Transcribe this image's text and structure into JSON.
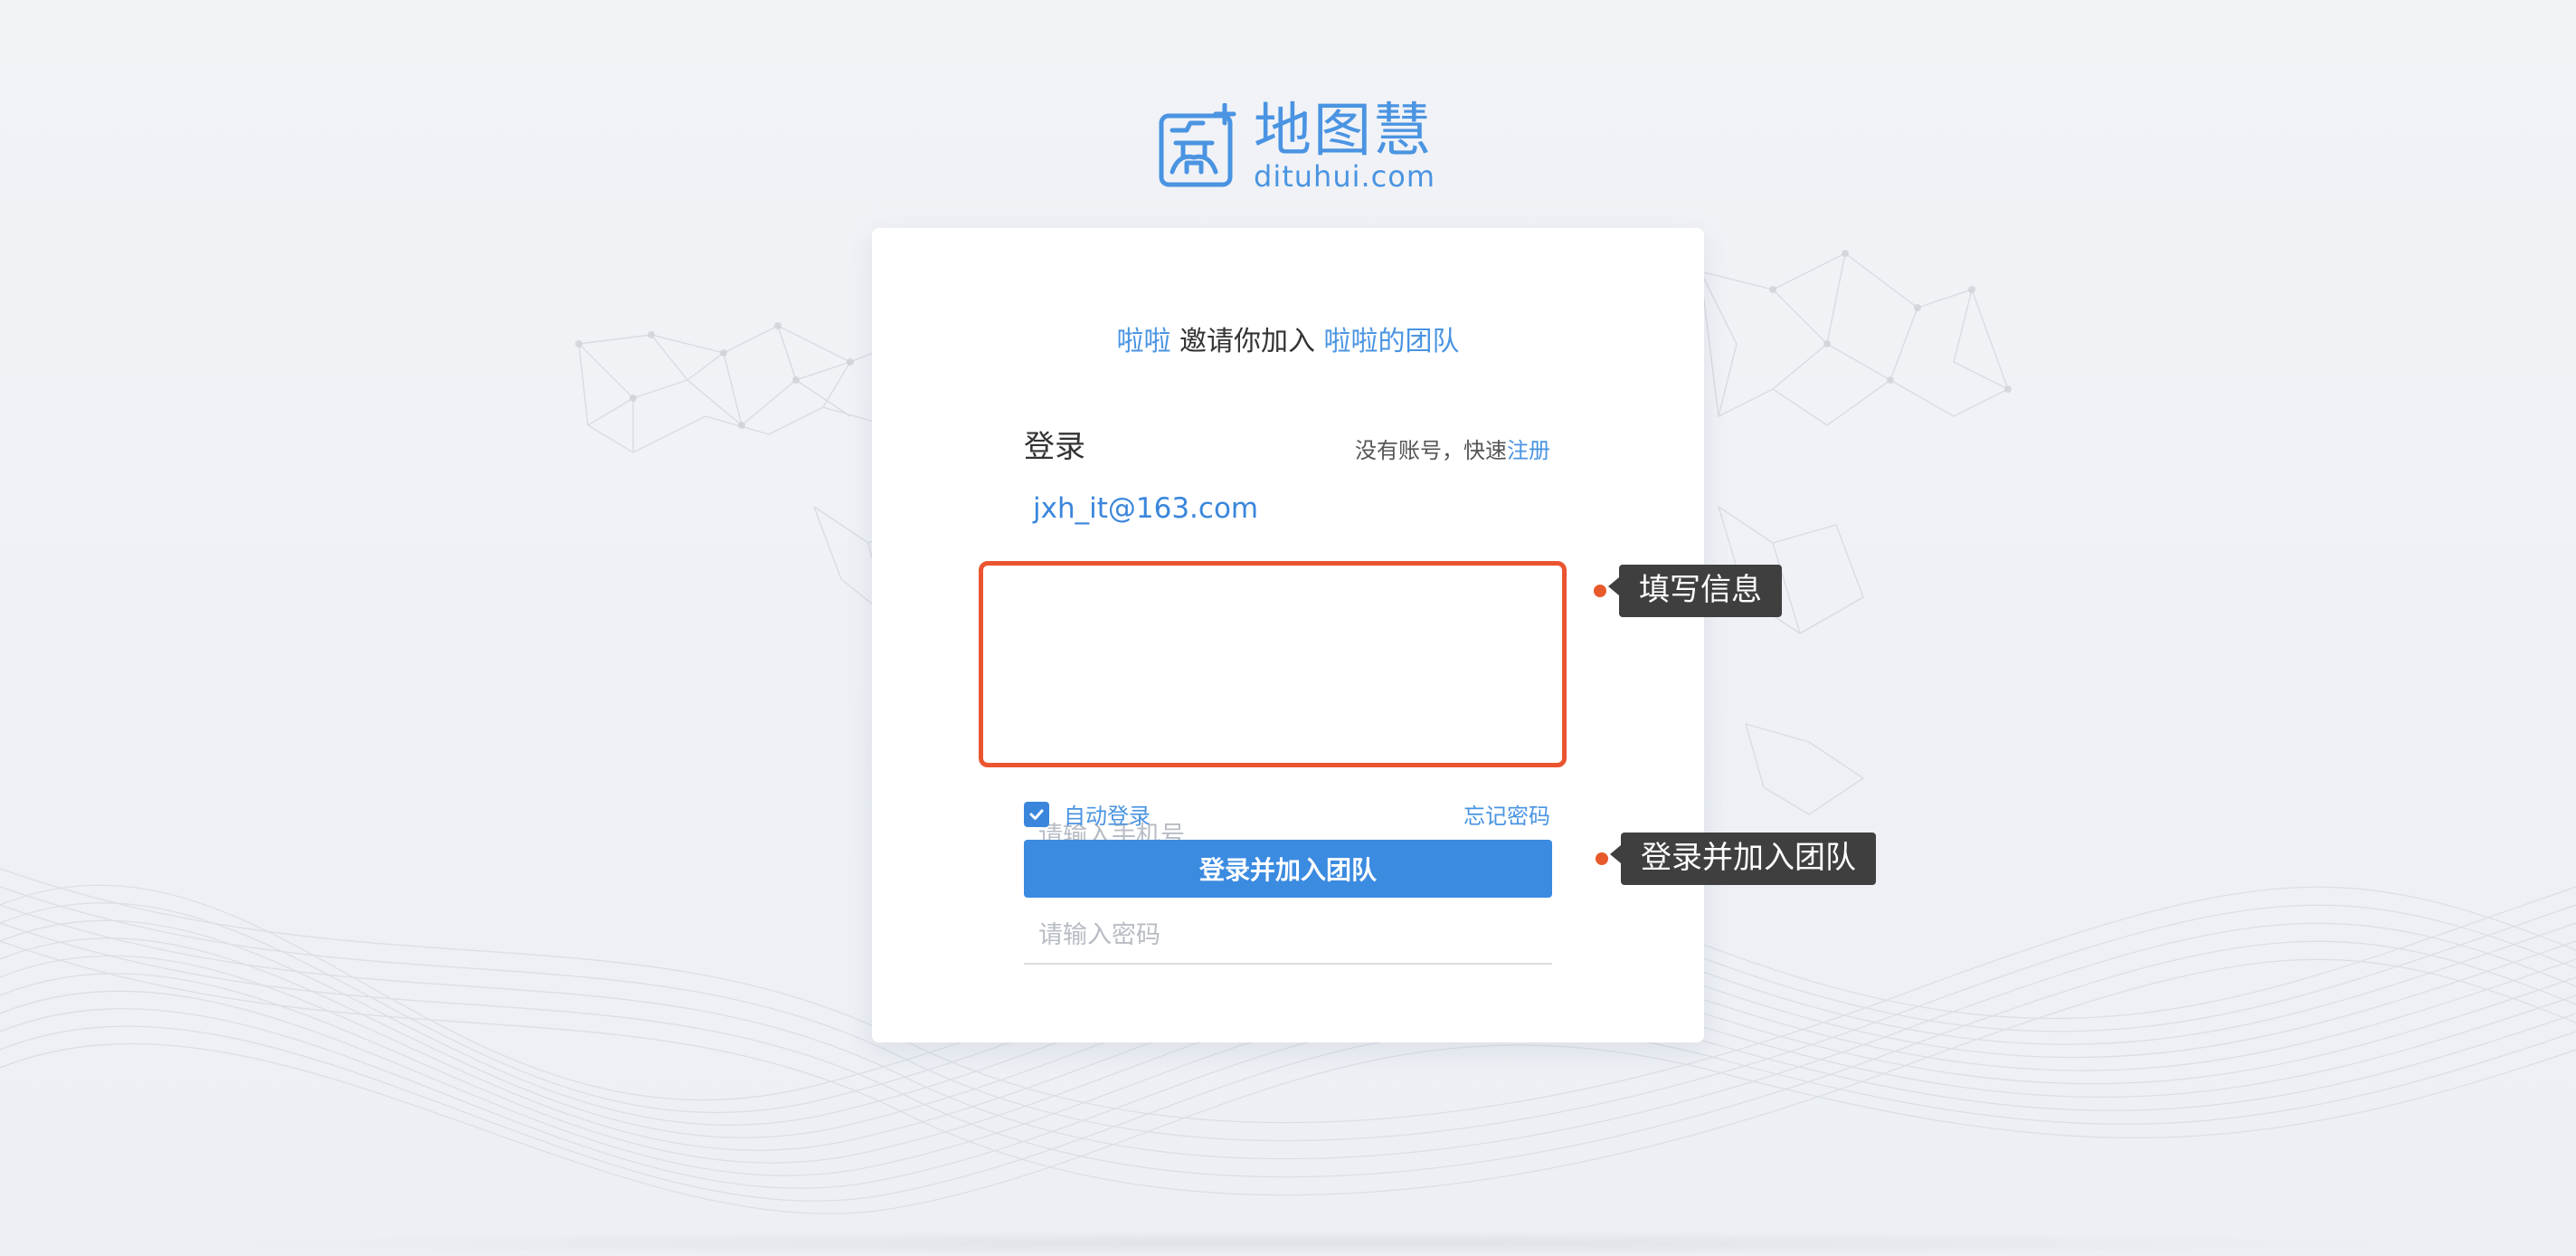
{
  "brand": {
    "name_cn": "地图慧",
    "domain": "dituhui.com",
    "color": "#4a94e2"
  },
  "invite": {
    "inviter": "啦啦",
    "text": "邀请你加入",
    "team": "啦啦的团队"
  },
  "login": {
    "title": "登录",
    "signup_prompt": "没有账号，快速",
    "signup_link": "注册",
    "email": "jxh_it@163.com",
    "phone_placeholder": "请输入手机号",
    "password_placeholder": "请输入密码",
    "remember_label": "自动登录",
    "remember_checked": true,
    "forgot_label": "忘记密码",
    "submit_label": "登录并加入团队"
  },
  "annotations": {
    "fill_info": "填写信息",
    "join_team": "登录并加入团队",
    "highlight_color": "#ea5530"
  }
}
